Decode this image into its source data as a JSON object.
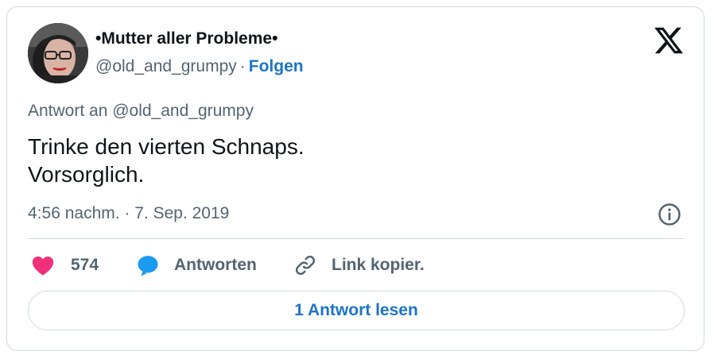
{
  "author": {
    "display_name": "•Mutter aller Probleme•",
    "handle": "@old_and_grumpy",
    "separator": "·",
    "follow_label": "Folgen"
  },
  "icons": {
    "brand": "x-logo-icon",
    "info": "info-icon",
    "like": "heart-icon",
    "reply": "speech-bubble-icon",
    "link": "link-icon"
  },
  "tweet": {
    "reply_to": "Antwort an @old_and_grumpy",
    "lines": [
      "Trinke den vierten Schnaps.",
      "Vorsorglich."
    ],
    "timestamp": "4:56 nachm. · 7. Sep. 2019"
  },
  "actions": {
    "like_count": "574",
    "reply_label": "Antworten",
    "link_label": "Link kopier."
  },
  "read_replies_label": "1 Antwort lesen",
  "colors": {
    "accent": "#1d73c9",
    "like": "#f0307a",
    "reply": "#1d9bf0",
    "muted": "#536471",
    "border": "#cfd9de"
  }
}
